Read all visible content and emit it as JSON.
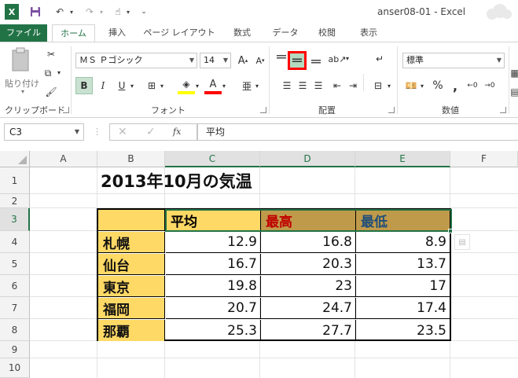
{
  "window": {
    "title": "anser08-01 - Excel"
  },
  "quick_access": {
    "app_icon": "X",
    "save_icon": "save-icon",
    "undo_icon": "undo-icon",
    "redo_icon": "redo-icon"
  },
  "tabs": [
    {
      "label": "ファイル"
    },
    {
      "label": "ホーム"
    },
    {
      "label": "挿入"
    },
    {
      "label": "ページ レイアウト"
    },
    {
      "label": "数式"
    },
    {
      "label": "データ"
    },
    {
      "label": "校閲"
    },
    {
      "label": "表示"
    }
  ],
  "ribbon": {
    "clipboard": {
      "label": "クリップボード",
      "paste_label": "貼り付け"
    },
    "font": {
      "label": "フォント",
      "font_name": "ＭＳ Ｐゴシック",
      "font_size": "14",
      "grow": "A",
      "shrink": "A",
      "bold": "B",
      "italic": "I",
      "underline": "U",
      "font_color_letter": "A",
      "phonetic": "亜"
    },
    "alignment": {
      "label": "配置"
    },
    "number": {
      "label": "数値",
      "format": "標準",
      "percent": "%",
      "comma": ","
    },
    "colors": {
      "accent": "#217346",
      "highlight_selected": "#c8e1d0",
      "selection_marker": "#ff0000"
    }
  },
  "formula_bar": {
    "name_box": "C3",
    "fx": "fx",
    "content": "平均"
  },
  "columns": [
    "A",
    "B",
    "C",
    "D",
    "E",
    "F"
  ],
  "rows": [
    "1",
    "2",
    "3",
    "4",
    "5",
    "6",
    "7",
    "8",
    "9",
    "10"
  ],
  "sheet": {
    "title": "2013年10月の気温",
    "headers": [
      {
        "text": "平均",
        "color": "#000000",
        "bg": "#ffd966"
      },
      {
        "text": "最高",
        "color": "#c00000",
        "bg": "#bf9a4a"
      },
      {
        "text": "最低",
        "color": "#1f4e79",
        "bg": "#bf9a4a"
      }
    ],
    "data_rows": [
      {
        "city": "札幌",
        "values": [
          "12.9",
          "16.8",
          "8.9"
        ]
      },
      {
        "city": "仙台",
        "values": [
          "16.7",
          "20.3",
          "13.7"
        ]
      },
      {
        "city": "東京",
        "values": [
          "19.8",
          "23",
          "17"
        ]
      },
      {
        "city": "福岡",
        "values": [
          "20.7",
          "24.7",
          "17.4"
        ]
      },
      {
        "city": "那覇",
        "values": [
          "25.3",
          "27.7",
          "23.5"
        ]
      }
    ]
  }
}
